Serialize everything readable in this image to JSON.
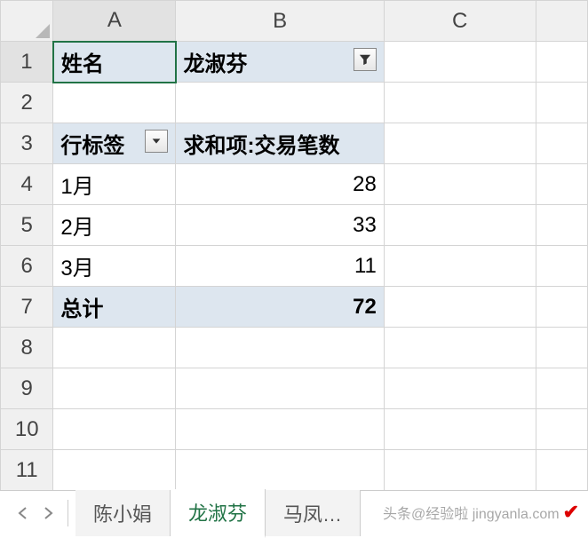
{
  "columns": {
    "A": "A",
    "B": "B",
    "C": "C"
  },
  "rows": [
    "1",
    "2",
    "3",
    "4",
    "5",
    "6",
    "7",
    "8",
    "9",
    "10",
    "11"
  ],
  "filter": {
    "label": "姓名",
    "value": "龙淑芬"
  },
  "pivot": {
    "row_label_header": "行标签",
    "value_header": "求和项:交易笔数",
    "rows": [
      {
        "label": "1月",
        "value": "28"
      },
      {
        "label": "2月",
        "value": "33"
      },
      {
        "label": "3月",
        "value": "11"
      }
    ],
    "total_label": "总计",
    "total_value": "72"
  },
  "tabs": {
    "prev": "陈小娟",
    "active": "龙淑芬",
    "next": "马凤…"
  },
  "watermark": "头条@经验啦 jingyanla.com",
  "chart_data": {
    "type": "table",
    "title": "求和项:交易笔数",
    "filter": {
      "field": "姓名",
      "value": "龙淑芬"
    },
    "categories": [
      "1月",
      "2月",
      "3月"
    ],
    "values": [
      28,
      33,
      11
    ],
    "total": 72
  }
}
